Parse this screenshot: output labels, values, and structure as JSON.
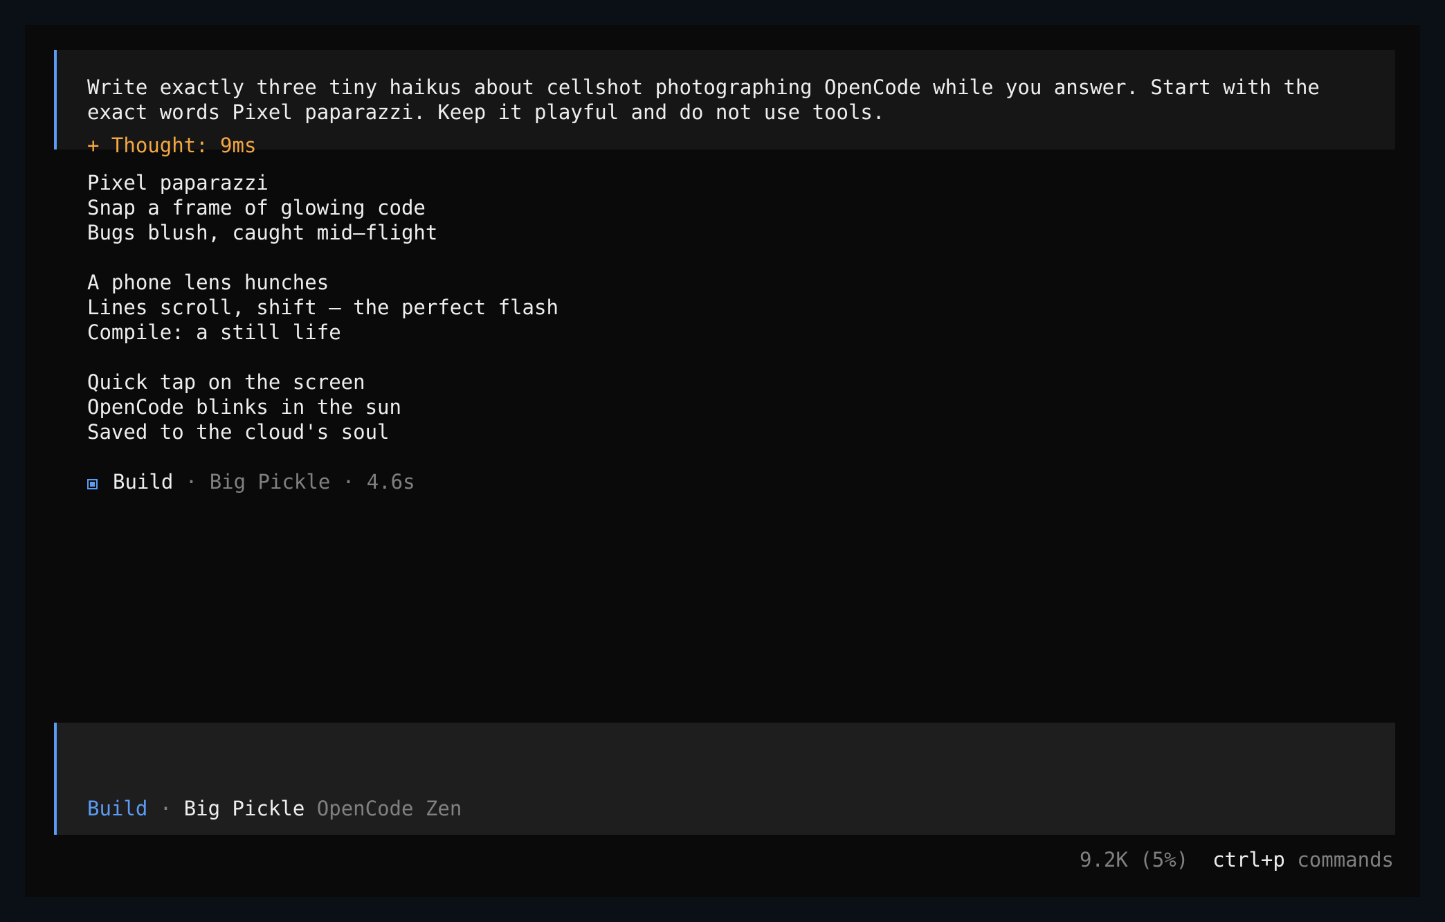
{
  "prompt": {
    "text": "Write exactly three tiny haikus about cellshot photographing OpenCode while you answer. Start with the exact words Pixel paparazzi. Keep it playful and do not use tools."
  },
  "thought": {
    "label": "+ Thought: 9ms"
  },
  "haikus": [
    [
      "Pixel paparazzi",
      "Snap a frame of glowing code",
      "Bugs blush, caught mid–flight"
    ],
    [
      "A phone lens hunches",
      "Lines scroll, shift — the perfect flash",
      "Compile: a still life"
    ],
    [
      "Quick tap on the screen",
      "OpenCode blinks in the sun",
      "Saved to the cloud's soul"
    ]
  ],
  "status": {
    "icon": "build-square-icon",
    "agent": "Build",
    "separator": " · ",
    "model": "Big Pickle",
    "duration": "4.6s"
  },
  "input": {
    "agent": "Build",
    "separator": " · ",
    "model": "Big Pickle",
    "provider": "OpenCode Zen"
  },
  "footer": {
    "tokens": "9.2K (5%)",
    "shortcut": "ctrl+p",
    "shortcut_label": "commands"
  },
  "colors": {
    "accent": "#5c9cf5",
    "thought": "#f5a742",
    "background": "#0a0a0a",
    "text": "#eeeeee",
    "muted": "#808080"
  }
}
